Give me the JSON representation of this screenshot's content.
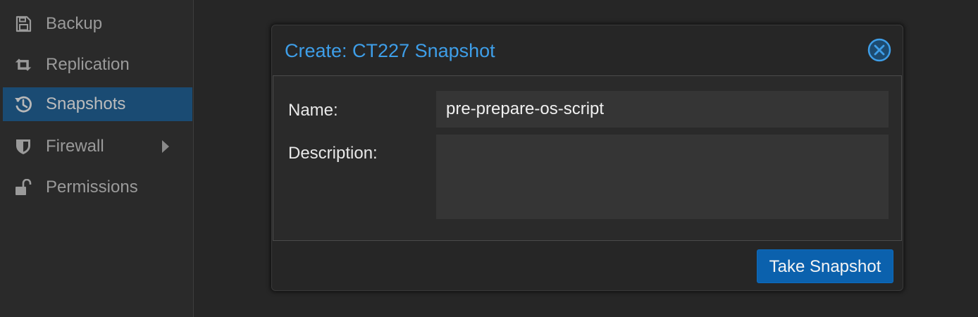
{
  "sidebar": {
    "items": [
      {
        "label": "Backup",
        "icon": "floppy-disk-icon",
        "active": false
      },
      {
        "label": "Replication",
        "icon": "retweet-icon",
        "active": false
      },
      {
        "label": "Snapshots",
        "icon": "history-icon",
        "active": true
      },
      {
        "label": "Firewall",
        "icon": "shield-icon",
        "active": false,
        "has_submenu": true
      },
      {
        "label": "Permissions",
        "icon": "unlock-icon",
        "active": false
      }
    ]
  },
  "dialog": {
    "title": "Create: CT227 Snapshot",
    "close_icon": "close-circle-icon",
    "fields": {
      "name_label": "Name:",
      "name_value": "pre-prepare-os-script",
      "description_label": "Description:",
      "description_value": ""
    },
    "submit_label": "Take Snapshot"
  },
  "colors": {
    "accent_title": "#3e9ee8",
    "active_item_bg": "#1a4b73",
    "primary_button": "#0b61ad",
    "background": "#262626"
  }
}
